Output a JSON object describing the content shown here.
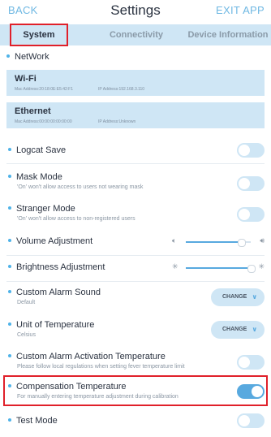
{
  "header": {
    "back": "BACK",
    "title": "Settings",
    "exit": "EXIT APP"
  },
  "tabs": {
    "system": "System",
    "connectivity": "Connectivity",
    "device": "Device Information"
  },
  "network": {
    "section": "NetWork",
    "wifi": {
      "title": "Wi-Fi",
      "mac": "Mac Address:20:18:0E:E5:42:F1",
      "ip": "IP Address:192.168.3.110"
    },
    "ethernet": {
      "title": "Ethernet",
      "mac": "Mac Address:00:00:00:00:00:00",
      "ip": "IP Address:Unknown"
    }
  },
  "settings": {
    "logcat": {
      "label": "Logcat Save",
      "on": false
    },
    "mask": {
      "label": "Mask Mode",
      "sub": "'On' won't allow access to users not wearing mask",
      "on": false
    },
    "stranger": {
      "label": "Stranger Mode",
      "sub": "'On' won't allow access to non-registered users",
      "on": false
    },
    "volume": {
      "label": "Volume Adjustment",
      "level": 0.85
    },
    "brightness": {
      "label": "Brightness Adjustment",
      "level": 1.0
    },
    "alarm_sound": {
      "label": "Custom Alarm Sound",
      "sub": "Default",
      "button": "CHANGE"
    },
    "temp_unit": {
      "label": "Unit of Temperature",
      "sub": "Celsius",
      "button": "CHANGE"
    },
    "alarm_temp": {
      "label": "Custom Alarm Activation Temperature",
      "sub": "Please follow local regulations when setting fever temperature limit",
      "on": false
    },
    "compensation": {
      "label": "Compensation Temperature",
      "sub": "For manually entering temperature adjustment during calibration",
      "on": true
    },
    "test_mode": {
      "label": "Test Mode",
      "on": false
    }
  },
  "colors": {
    "accent": "#58a9df",
    "highlight": "#e0202a",
    "panel": "#cfe6f5"
  }
}
